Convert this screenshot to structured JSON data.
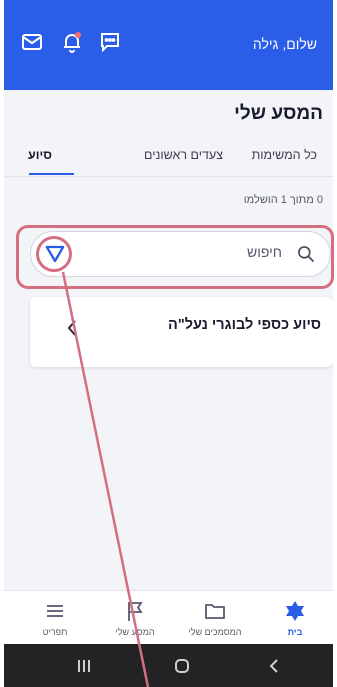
{
  "header": {
    "greeting": "שלום, גילה",
    "icons": [
      "mail-icon",
      "notification-bell-icon",
      "chat-icon"
    ],
    "brand_color": "#2a5ee8"
  },
  "page": {
    "title": "המסע שלי"
  },
  "tabs": [
    {
      "label": "כל המשימות",
      "active": false
    },
    {
      "label": "צעדים ראשונים",
      "active": false
    },
    {
      "label": "סיוע",
      "active": true
    }
  ],
  "progress_text": "0 מתוך 1 הושלמו",
  "search": {
    "placeholder": "חיפוש",
    "value": ""
  },
  "tasks": [
    {
      "title": "סיוע כספי לבוגרי נעל\"ה"
    }
  ],
  "bottom_nav": [
    {
      "label": "בית",
      "icon": "star-of-david-icon",
      "active": true
    },
    {
      "label": "המסמכים שלי",
      "icon": "folder-icon",
      "active": false
    },
    {
      "label": "המסע שלי",
      "icon": "flag-icon",
      "active": false
    },
    {
      "label": "תפריט",
      "icon": "menu-icon",
      "active": false
    }
  ],
  "annotation_color": "#d46f82"
}
